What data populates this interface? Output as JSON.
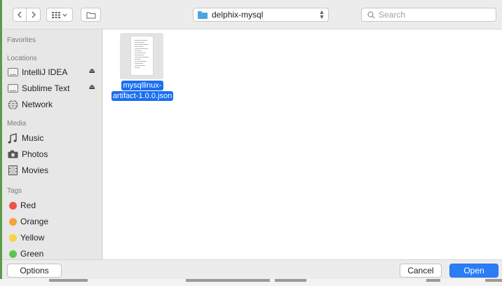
{
  "toolbar": {
    "back_icon": "chevron-left-icon",
    "forward_icon": "chevron-right-icon",
    "view_icon": "icon-grid-icon",
    "new_folder_icon": "new-folder-icon",
    "location": "delphix-mysql",
    "search_placeholder": "Search"
  },
  "sidebar": {
    "favorites_heading": "Favorites",
    "locations_heading": "Locations",
    "locations": [
      {
        "label": "IntelliJ IDEA",
        "icon": "disk-icon",
        "ejectable": true
      },
      {
        "label": "Sublime Text",
        "icon": "disk-icon",
        "ejectable": true
      },
      {
        "label": "Network",
        "icon": "network-globe-icon"
      }
    ],
    "media_heading": "Media",
    "media": [
      {
        "label": "Music",
        "icon": "music-note-icon"
      },
      {
        "label": "Photos",
        "icon": "camera-icon"
      },
      {
        "label": "Movies",
        "icon": "film-icon"
      }
    ],
    "tags_heading": "Tags",
    "tags": [
      {
        "label": "Red",
        "color": "#f0504a"
      },
      {
        "label": "Orange",
        "color": "#f7a23b"
      },
      {
        "label": "Yellow",
        "color": "#f8d34a"
      },
      {
        "label": "Green",
        "color": "#58c84b"
      }
    ]
  },
  "files": [
    {
      "name": "mysqllinux-artifact-1.0.0.json",
      "name_line1": "mysqllinux-",
      "name_line2": "artifact-1.0.0.json",
      "selected": true
    }
  ],
  "buttons": {
    "options": "Options",
    "cancel": "Cancel",
    "open": "Open"
  },
  "accent_color": "#2c7cf6"
}
